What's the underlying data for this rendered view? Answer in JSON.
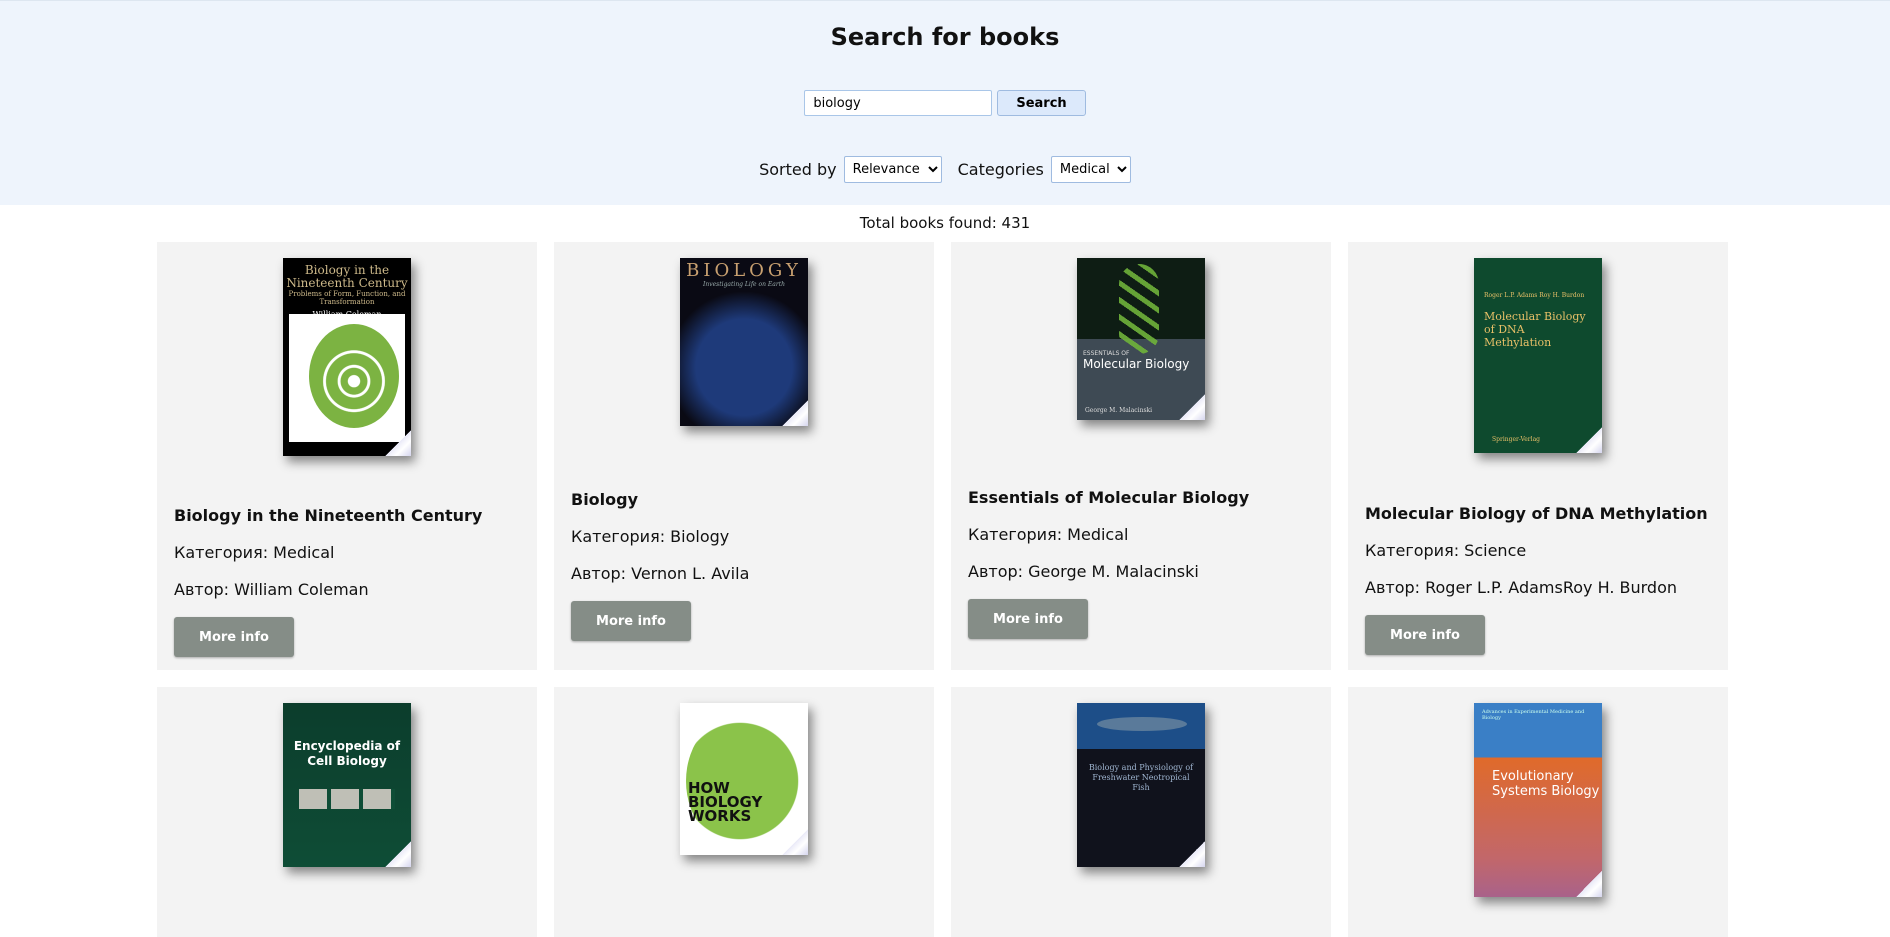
{
  "header": {
    "title": "Search for books",
    "search_value": "biology",
    "search_button": "Search",
    "sort_label": "Sorted by",
    "sort_selected": "Relevance",
    "categories_label": "Categories",
    "categories_selected": "Medical"
  },
  "results": {
    "total_text": "Total books found: 431"
  },
  "books": [
    {
      "title": "Biology in the Nineteenth Century",
      "category": "Категория: Medical",
      "author": "Автор: William Coleman",
      "more": "More info",
      "cover_title": "Biology in the Nineteenth Century",
      "cover_sub": "Problems of Form, Function, and Transformation",
      "cover_author": "William Coleman"
    },
    {
      "title": "Biology",
      "category": "Категория: Biology",
      "author": "Автор: Vernon L. Avila",
      "more": "More info",
      "cover_title": "BIOLOGY",
      "cover_sub": "Investigating Life on Earth"
    },
    {
      "title": "Essentials of Molecular Biology",
      "category": "Категория: Medical",
      "author": "Автор: George M. Malacinski",
      "more": "More info",
      "cover_title": "Molecular Biology",
      "cover_pre": "ESSENTIALS OF",
      "cover_author": "George M. Malacinski"
    },
    {
      "title": "Molecular Biology of DNA Methylation",
      "category": "Категория: Science",
      "author": "Автор: Roger L.P. AdamsRoy H. Burdon",
      "more": "More info",
      "cover_title": "Molecular Biology of DNA Methylation",
      "cover_author": "Roger L.P. Adams Roy H. Burdon",
      "cover_pub": "Springer-Verlag"
    },
    {
      "cover_title": "Encyclopedia of Cell Biology"
    },
    {
      "cover_title": "HOW BIOLOGY WORKS"
    },
    {
      "cover_title": "Biology and Physiology of Freshwater Neotropical Fish"
    },
    {
      "cover_title": "Evolutionary Systems Biology",
      "cover_sub": "Advances in Experimental Medicine and Biology"
    }
  ]
}
